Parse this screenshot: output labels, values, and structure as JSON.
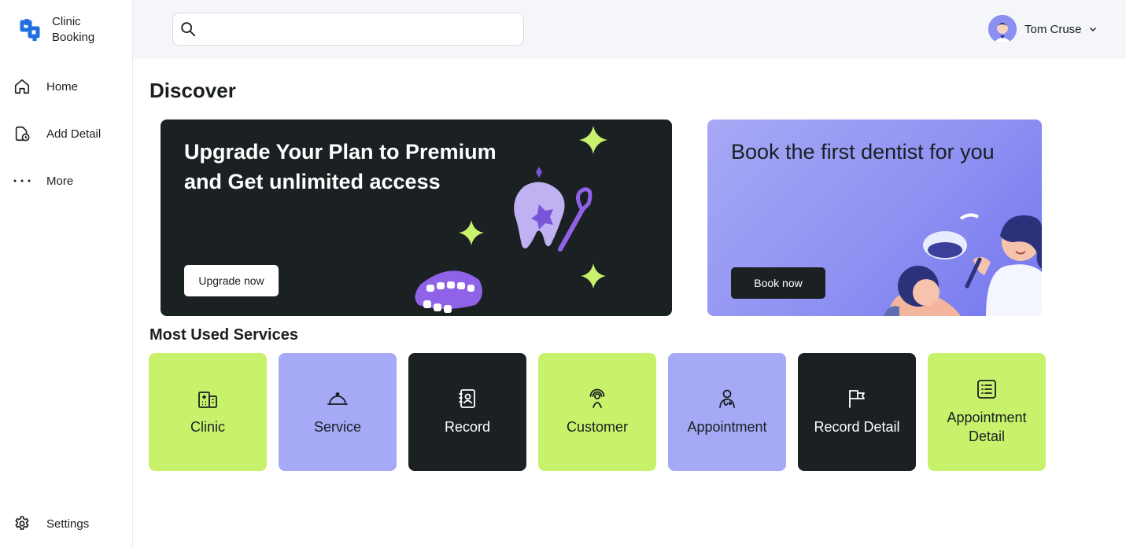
{
  "app": {
    "name": "Clinic Booking",
    "brand_color": "#1f6fe0"
  },
  "sidebar": {
    "items": [
      {
        "label": "Home",
        "icon": "home-icon"
      },
      {
        "label": "Add Detail",
        "icon": "file-clock-icon"
      },
      {
        "label": "More",
        "icon": "more-dots-icon"
      }
    ],
    "settings_label": "Settings"
  },
  "topbar": {
    "search": {
      "value": "",
      "placeholder": ""
    },
    "user": {
      "name": "Tom Cruse"
    }
  },
  "main": {
    "title": "Discover",
    "banners": [
      {
        "headline": "Upgrade Your Plan to Premium and Get unlimited access",
        "cta": "Upgrade now",
        "bg": "#1b2023"
      },
      {
        "headline": "Book the first dentist for you",
        "cta": "Book now",
        "bg": "#8f91f2"
      }
    ],
    "services_title": "Most Used Services",
    "services": [
      {
        "label": "Clinic",
        "icon": "hospital-icon",
        "color": "#c8f26c"
      },
      {
        "label": "Service",
        "icon": "service-bell-icon",
        "color": "#a6a9f5"
      },
      {
        "label": "Record",
        "icon": "contact-book-icon",
        "color": "#1b2023"
      },
      {
        "label": "Customer",
        "icon": "person-signal-icon",
        "color": "#c8f26c"
      },
      {
        "label": "Appointment",
        "icon": "doctor-icon",
        "color": "#a6a9f5"
      },
      {
        "label": "Record Detail",
        "icon": "flags-icon",
        "color": "#1b2023"
      },
      {
        "label": "Appointment Detail",
        "icon": "list-detail-icon",
        "color": "#c8f26c"
      }
    ]
  }
}
